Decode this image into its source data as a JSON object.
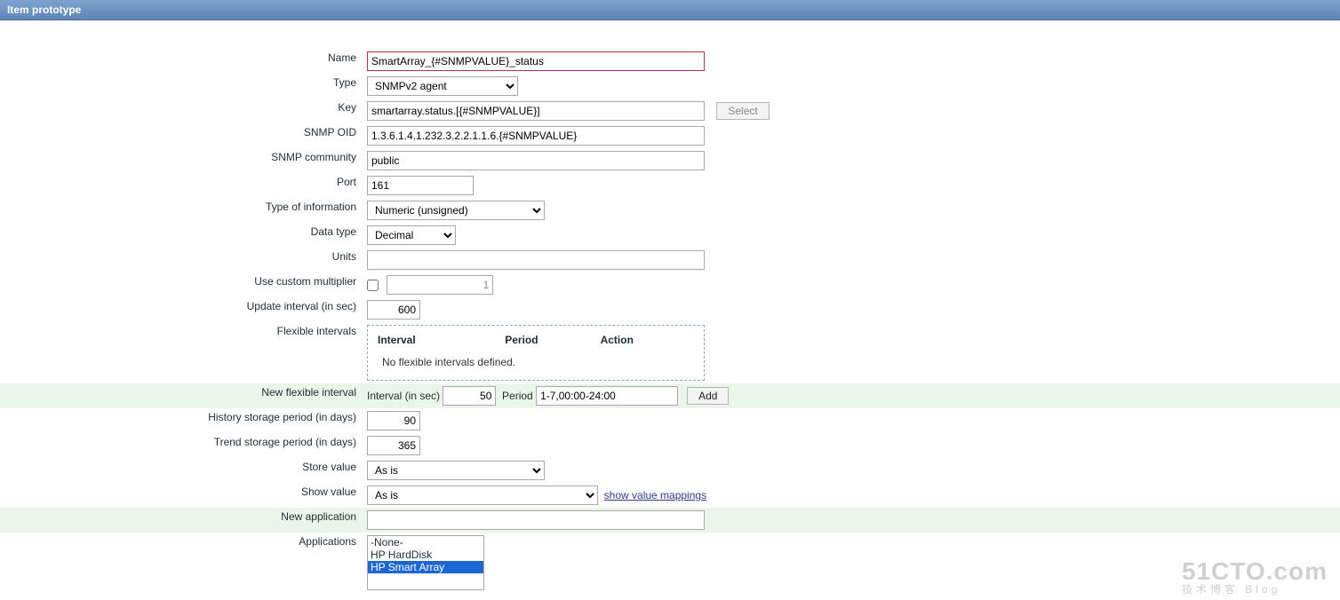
{
  "header": {
    "title": "Item prototype"
  },
  "labels": {
    "name": "Name",
    "type": "Type",
    "key": "Key",
    "snmp_oid": "SNMP OID",
    "snmp_community": "SNMP community",
    "port": "Port",
    "toi": "Type of information",
    "data_type": "Data type",
    "units": "Units",
    "use_mult": "Use custom multiplier",
    "update_interval": "Update interval (in sec)",
    "flex_intervals": "Flexible intervals",
    "new_flex": "New flexible interval",
    "history": "History storage period (in days)",
    "trend": "Trend storage period (in days)",
    "store_value": "Store value",
    "show_value": "Show value",
    "new_app": "New application",
    "applications": "Applications",
    "interval_in_sec": "Interval (in sec)",
    "period": "Period"
  },
  "fields": {
    "name": "SmartArray_{#SNMPVALUE}_status",
    "type_selected": "SNMPv2 agent",
    "key": "smartarray.status.[{#SNMPVALUE}]",
    "snmp_oid": "1.3.6.1.4.1.232.3.2.2.1.1.6.{#SNMPVALUE}",
    "snmp_community": "public",
    "port": "161",
    "toi_selected": "Numeric (unsigned)",
    "data_type_selected": "Decimal",
    "units": "",
    "use_mult_checked": false,
    "mult_value": "1",
    "update_interval": "600",
    "flex_cols": {
      "interval": "Interval",
      "period": "Period",
      "action": "Action"
    },
    "flex_empty": "No flexible intervals defined.",
    "new_flex_interval": "50",
    "new_flex_period": "1-7,00:00-24:00",
    "history": "90",
    "trend": "365",
    "store_value_selected": "As is",
    "show_value_selected": "As is",
    "new_app": "",
    "applications": [
      "-None-",
      "HP HardDisk",
      "HP Smart Array"
    ],
    "applications_selected_index": 2
  },
  "buttons": {
    "select": "Select",
    "add": "Add"
  },
  "links": {
    "show_value_mappings": "show value mappings"
  },
  "watermark": {
    "big": "51CTO.com",
    "small": "技术博客  Blog"
  }
}
